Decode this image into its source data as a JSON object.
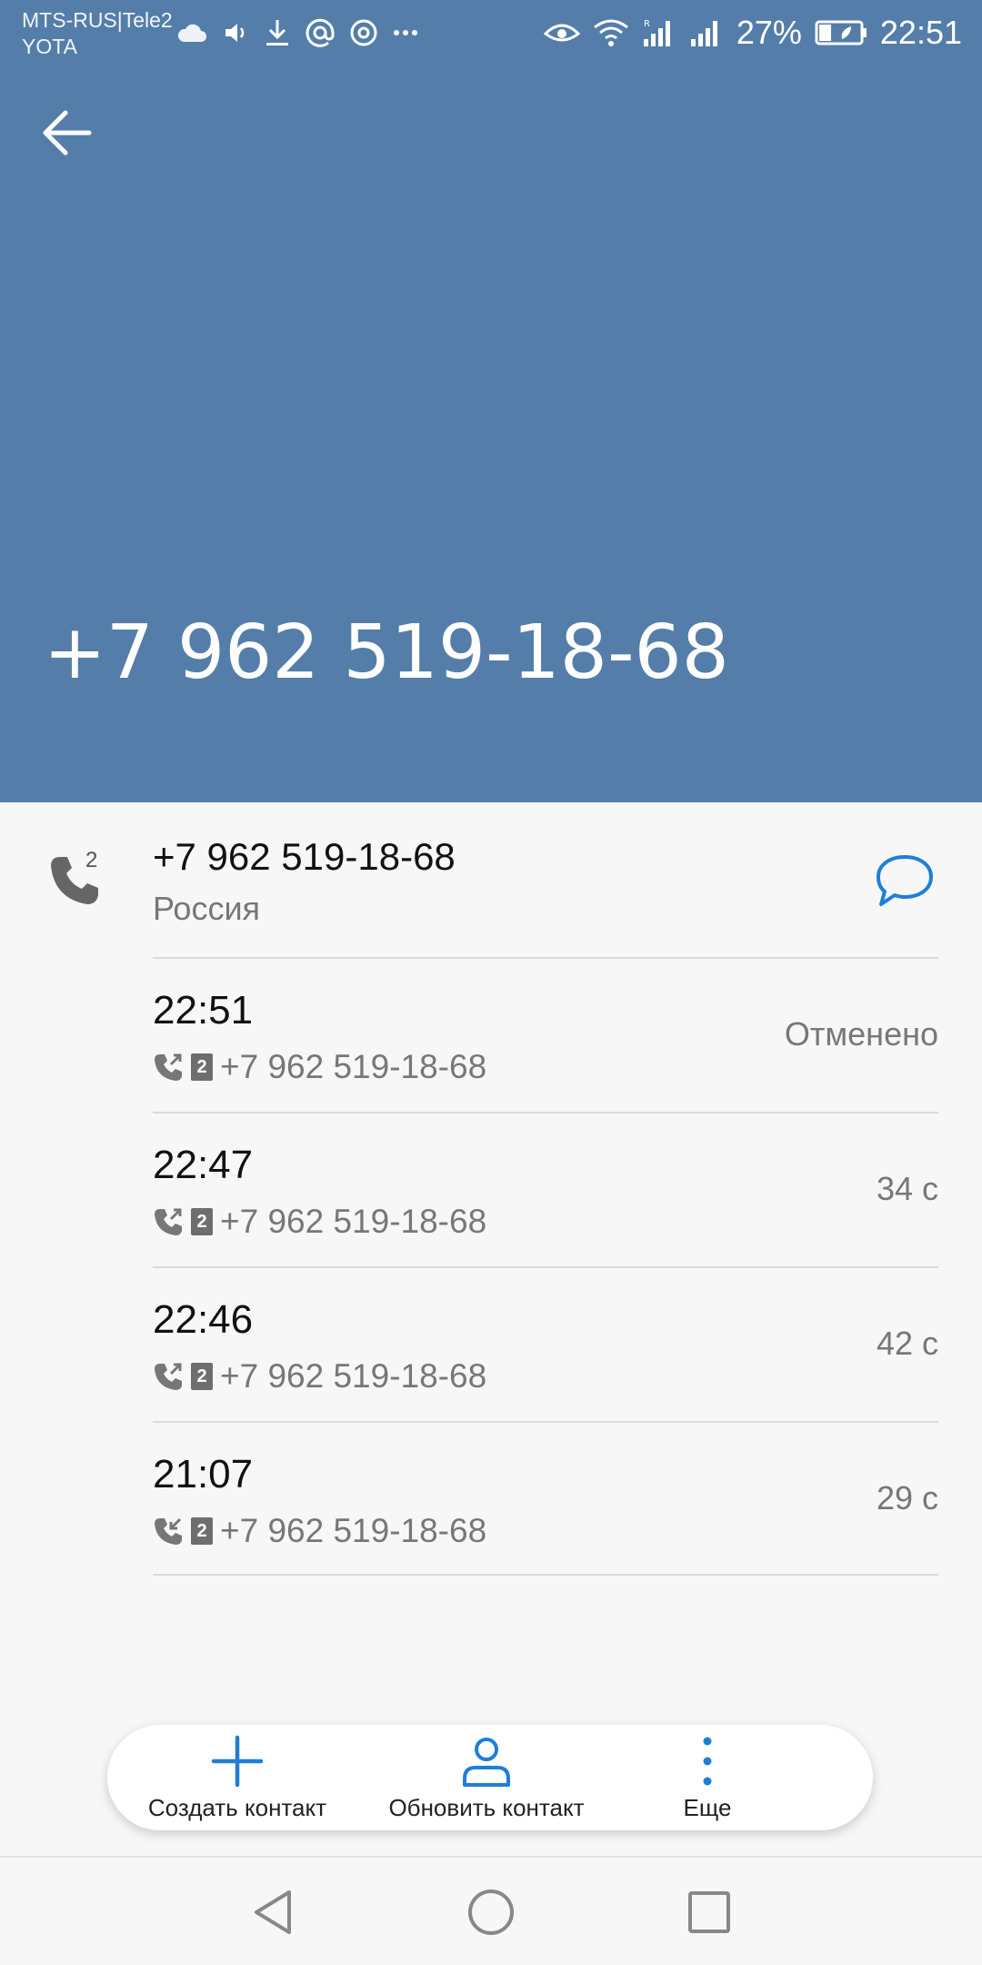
{
  "status_bar": {
    "carrier_line1": "MTS-RUS|Tele2",
    "carrier_line2": "YOTA",
    "battery_percent": "27%",
    "time": "22:51",
    "left_icons": [
      "cloud-icon",
      "volume-icon",
      "download-icon",
      "at-icon",
      "chrome-icon",
      "more-icon"
    ],
    "right_icons": [
      "eye-icon",
      "wifi-icon",
      "signal-roaming-icon",
      "signal-icon",
      "battery-icon"
    ]
  },
  "header": {
    "title": "+7 962 519-18-68",
    "color": "#547ea9"
  },
  "contact": {
    "number": "+7 962 519-18-68",
    "region": "Россия",
    "call_count": "2",
    "accent_color": "#1e7fd8"
  },
  "calls": [
    {
      "time": "22:51",
      "number": "+7 962 519-18-68",
      "sim": "2",
      "status": "Отменено",
      "direction": "outgoing"
    },
    {
      "time": "22:47",
      "number": "+7 962 519-18-68",
      "sim": "2",
      "status": "34 с",
      "direction": "outgoing"
    },
    {
      "time": "22:46",
      "number": "+7 962 519-18-68",
      "sim": "2",
      "status": "42 с",
      "direction": "outgoing"
    },
    {
      "time": "21:07",
      "number": "+7 962 519-18-68",
      "sim": "2",
      "status": "29 с",
      "direction": "incoming"
    }
  ],
  "actions": {
    "create_label": "Создать контакт",
    "update_label": "Обновить контакт",
    "more_label": "Еще"
  }
}
